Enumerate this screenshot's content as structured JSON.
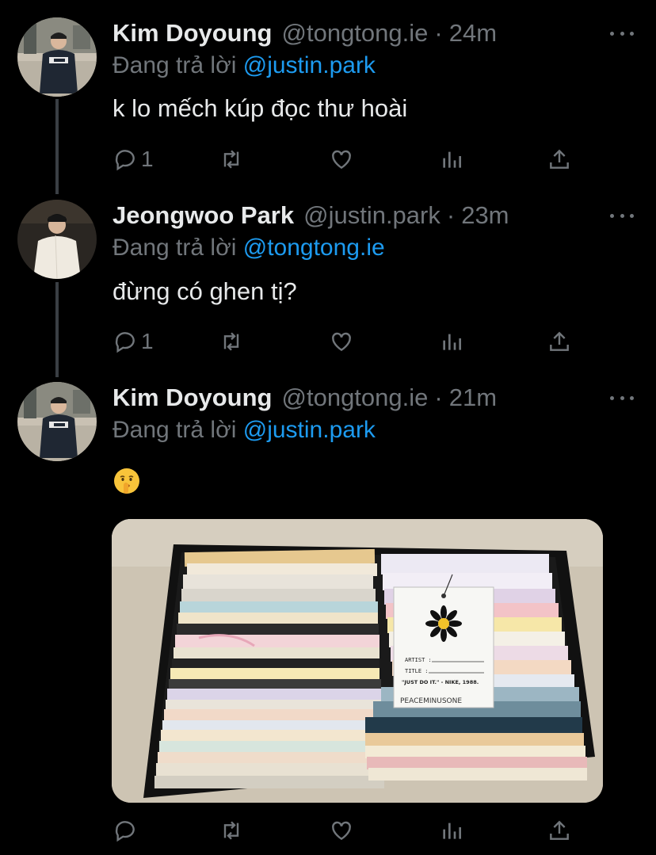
{
  "tweets": [
    {
      "name": "Kim Doyoung",
      "handle": "@tongtong.ie",
      "separator": "·",
      "time": "24m",
      "reply_prefix": "Đang trả lời",
      "reply_mention": "@justin.park",
      "text": "k lo mếch kúp đọc thư hoài",
      "reply_count": "1",
      "avatar_icon": "profile-photo"
    },
    {
      "name": "Jeongwoo Park",
      "handle": "@justin.park",
      "separator": "·",
      "time": "23m",
      "reply_prefix": "Đang trả lời",
      "reply_mention": "@tongtong.ie",
      "text": "đừng có ghen tị?",
      "reply_count": "1",
      "avatar_icon": "profile-photo"
    },
    {
      "name": "Kim Doyoung",
      "handle": "@tongtong.ie",
      "separator": "·",
      "time": "21m",
      "reply_prefix": "Đang trả lời",
      "reply_mention": "@justin.park",
      "emoji": "shushing-face",
      "media": {
        "description_icon": "photo-box-of-letters",
        "card": {
          "artist_label": "ARTIST :",
          "title_label": "TITLE :",
          "quote": "\"JUST DO IT.\" - NIKE, 1988.",
          "brand": "PEACEMINUSONE"
        }
      },
      "avatar_icon": "profile-photo"
    }
  ],
  "icons": {
    "reply": "reply-icon",
    "retweet": "retweet-icon",
    "like": "heart-icon",
    "views": "analytics-icon",
    "share": "share-icon",
    "more": "more-icon"
  },
  "colors": {
    "background": "#000000",
    "text": "#e7e9ea",
    "secondary": "#71767b",
    "accent": "#1d9bf0",
    "thread_line": "#3a3f44"
  }
}
